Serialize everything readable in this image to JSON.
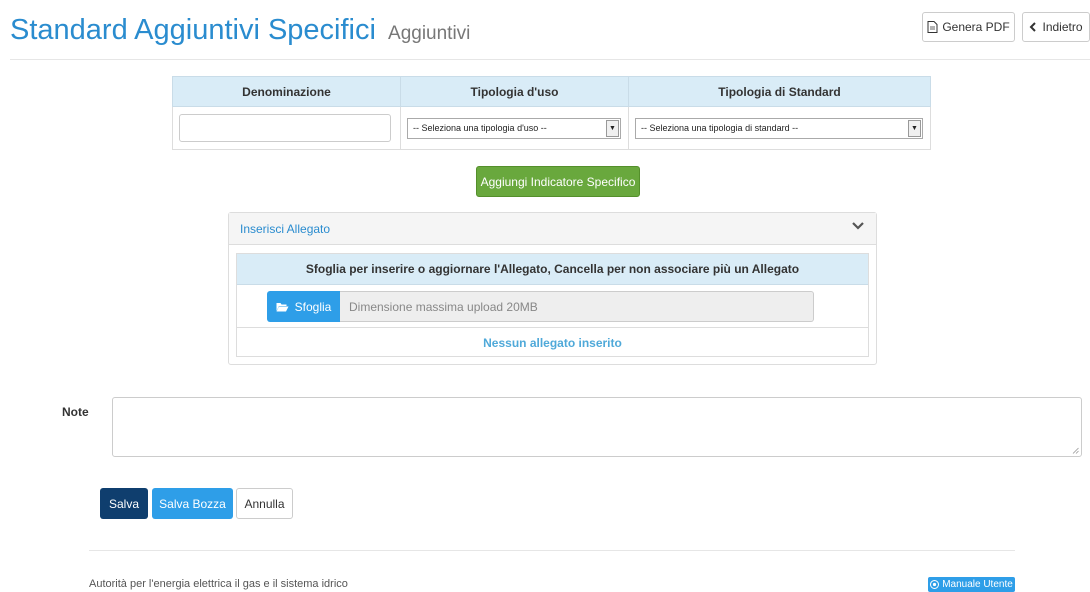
{
  "header": {
    "title": "Standard Aggiuntivi Specifici",
    "subtitle": "Aggiuntivi",
    "pdf_label": "Genera PDF",
    "back_label": "Indietro"
  },
  "table": {
    "columns": [
      "Denominazione",
      "Tipologia d'uso",
      "Tipologia di Standard"
    ],
    "usage_select": "-- Seleziona una tipologia d'uso --",
    "standard_select": "-- Seleziona una tipologia di standard --"
  },
  "add_button": "Aggiungi Indicatore Specifico",
  "attachment": {
    "panel_title": "Inserisci Allegato",
    "instructions": "Sfoglia per inserire o aggiornare l'Allegato, Cancella per non associare più un Allegato",
    "browse_label": "Sfoglia",
    "upload_info": "Dimensione massima upload 20MB",
    "empty_text": "Nessun allegato inserito"
  },
  "notes": {
    "label": "Note"
  },
  "actions": {
    "save": "Salva",
    "save_draft": "Salva Bozza",
    "cancel": "Annulla"
  },
  "footer": {
    "text": "Autorità per l'energia elettrica il gas e il sistema idrico",
    "manual": "Manuale Utente"
  },
  "colors": {
    "primary": "#2a8ccf",
    "success": "#69a83d",
    "info": "#2e9ee8",
    "dark": "#0f3e6e"
  }
}
